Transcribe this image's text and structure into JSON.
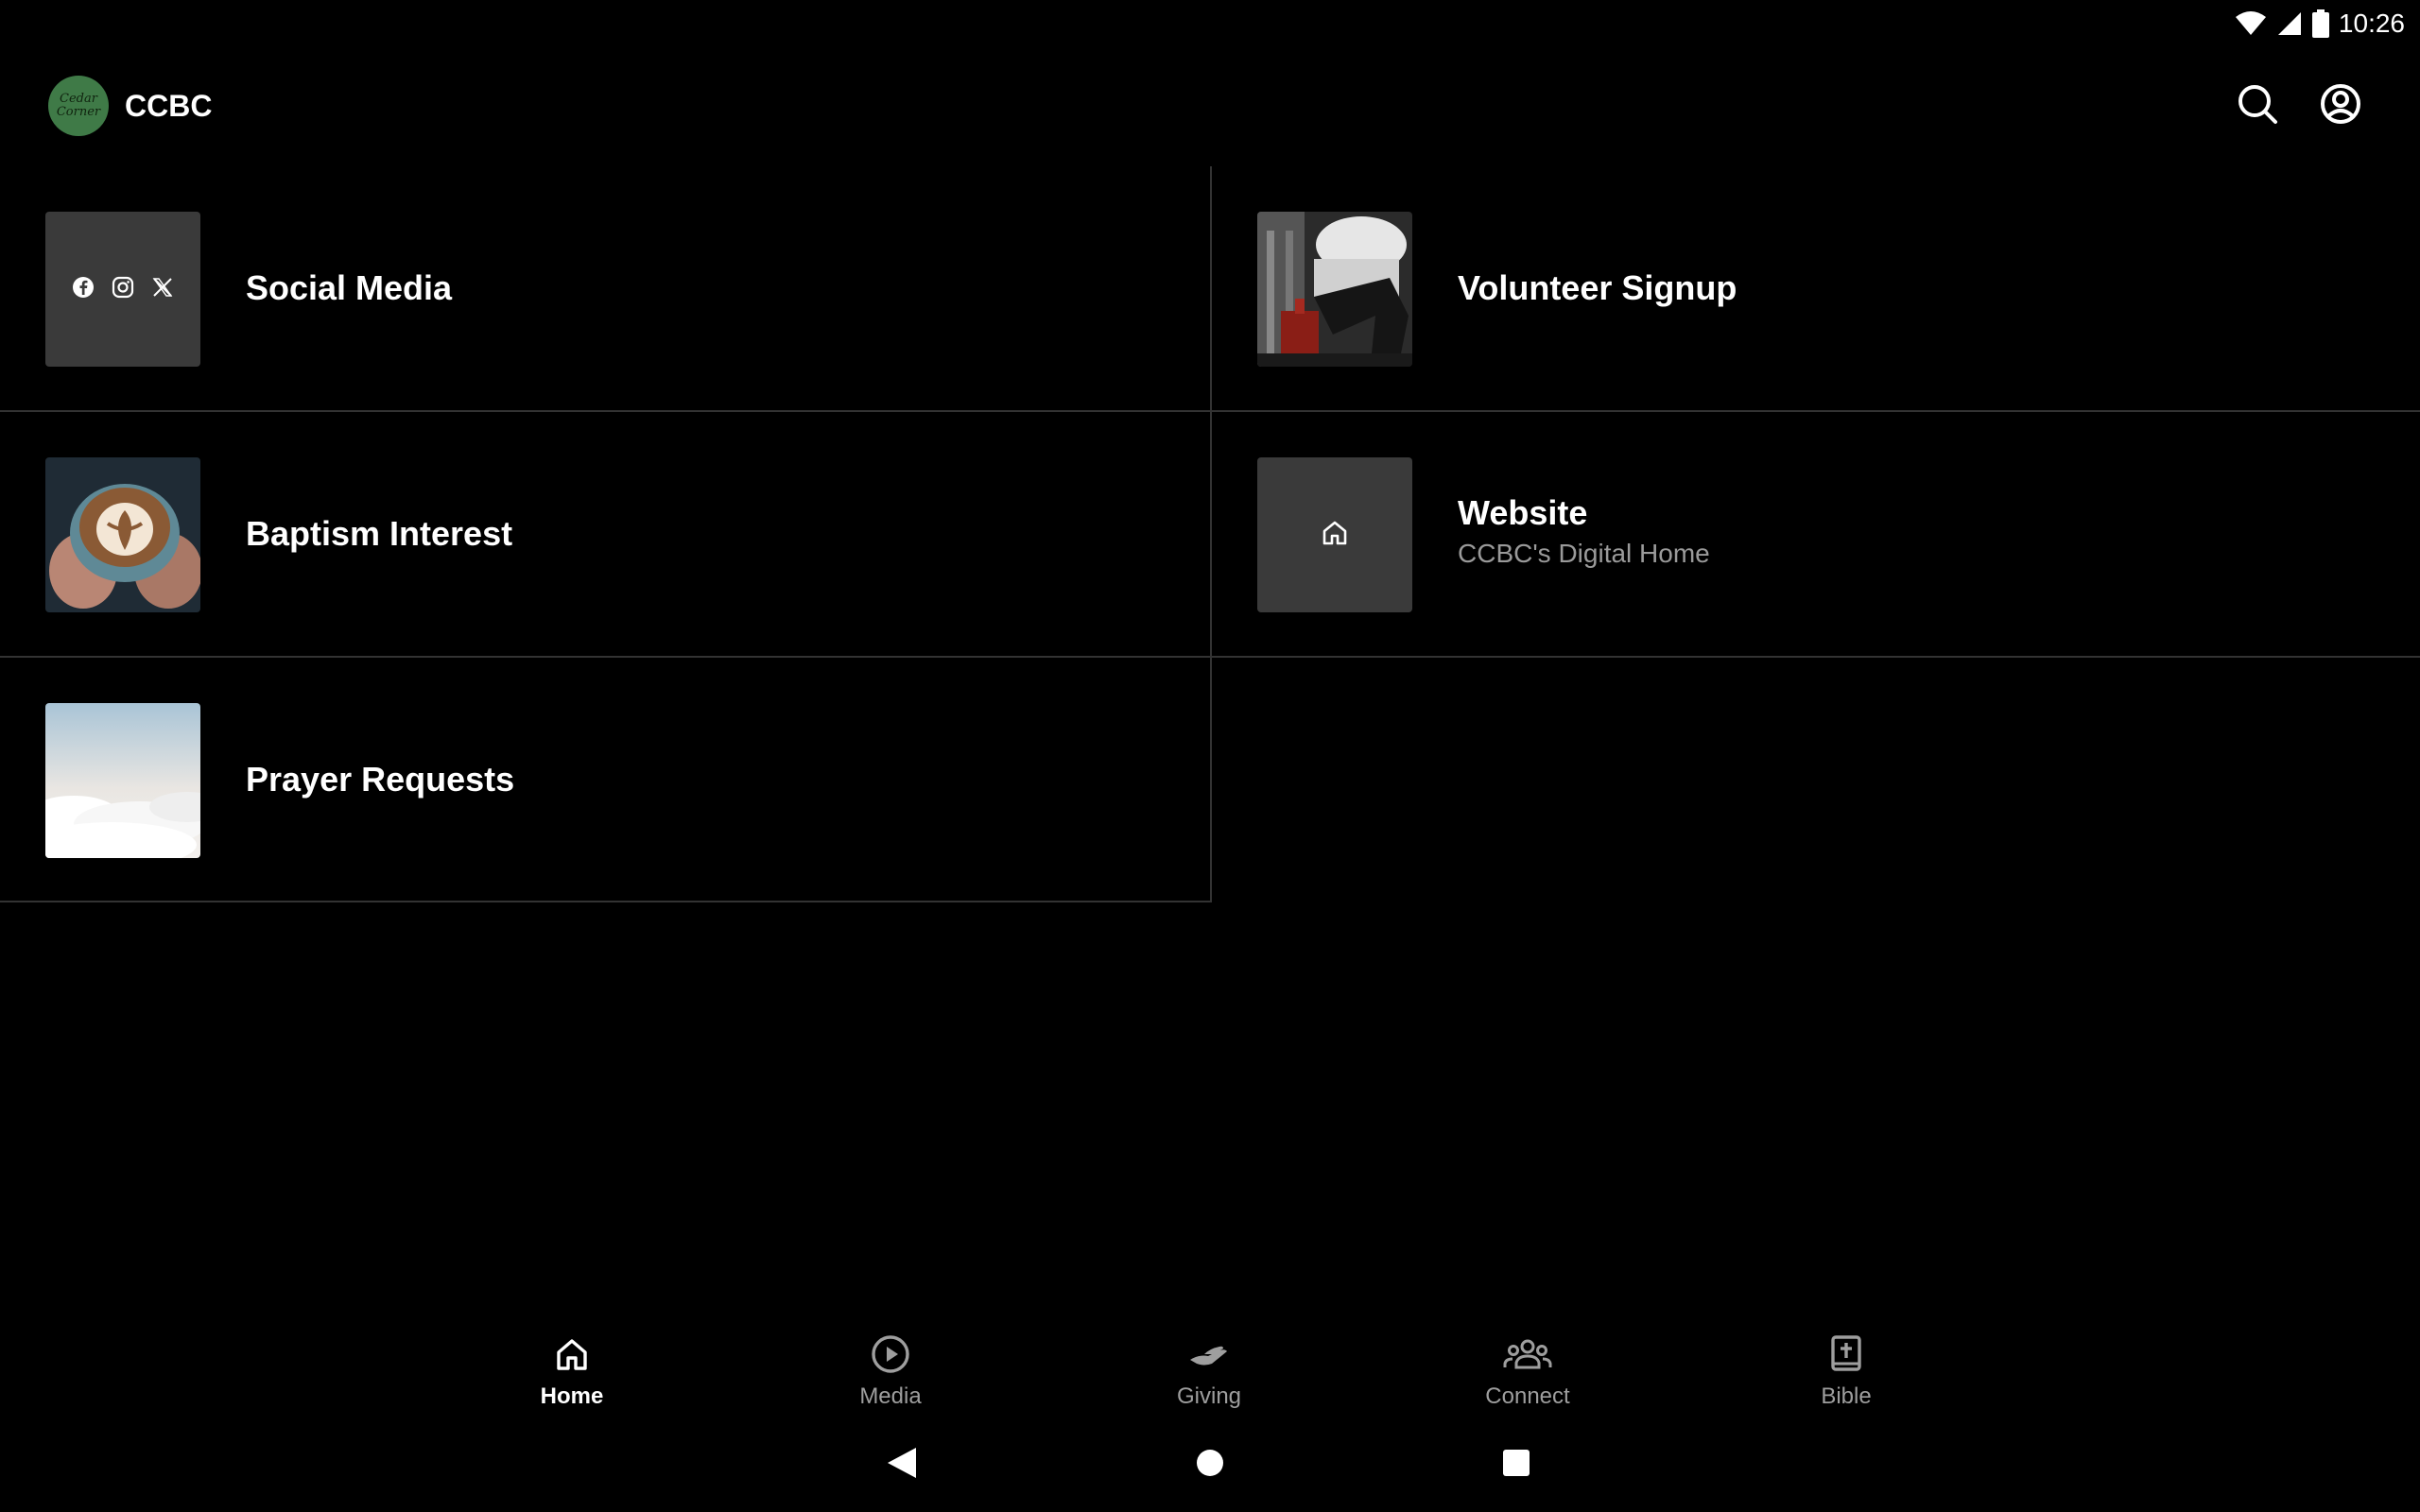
{
  "status_bar": {
    "time": "10:26",
    "icons": [
      "wifi-icon",
      "cellular-signal-icon",
      "battery-icon"
    ]
  },
  "app_bar": {
    "logo_text": "Cedar Corner",
    "title": "CCBC",
    "actions": [
      "search-icon",
      "account-circle-icon"
    ]
  },
  "tiles": [
    {
      "label": "Social Media",
      "subtitle": "",
      "thumb": "social-icons",
      "icons": [
        "facebook-icon",
        "instagram-icon",
        "x-icon"
      ]
    },
    {
      "label": "Volunteer Signup",
      "subtitle": "",
      "thumb": "photo-volunteer"
    },
    {
      "label": "Baptism Interest",
      "subtitle": "",
      "thumb": "photo-latte"
    },
    {
      "label": "Website",
      "subtitle": "CCBC's Digital Home",
      "thumb": "home-icon"
    },
    {
      "label": "Prayer Requests",
      "subtitle": "",
      "thumb": "photo-clouds"
    }
  ],
  "bottom_nav": {
    "items": [
      {
        "label": "Home",
        "icon": "home-icon",
        "active": true
      },
      {
        "label": "Media",
        "icon": "play-circle-icon",
        "active": false
      },
      {
        "label": "Giving",
        "icon": "giving-hand-icon",
        "active": false
      },
      {
        "label": "Connect",
        "icon": "groups-icon",
        "active": false
      },
      {
        "label": "Bible",
        "icon": "bible-icon",
        "active": false
      }
    ]
  },
  "system_nav": [
    "back-icon",
    "home-circle-icon",
    "recents-icon"
  ],
  "colors": {
    "background": "#000000",
    "divider": "#333333",
    "thumb_dark": "#3a3a3a",
    "inactive": "#9e9e9e",
    "logo_green": "#3f7a47"
  }
}
